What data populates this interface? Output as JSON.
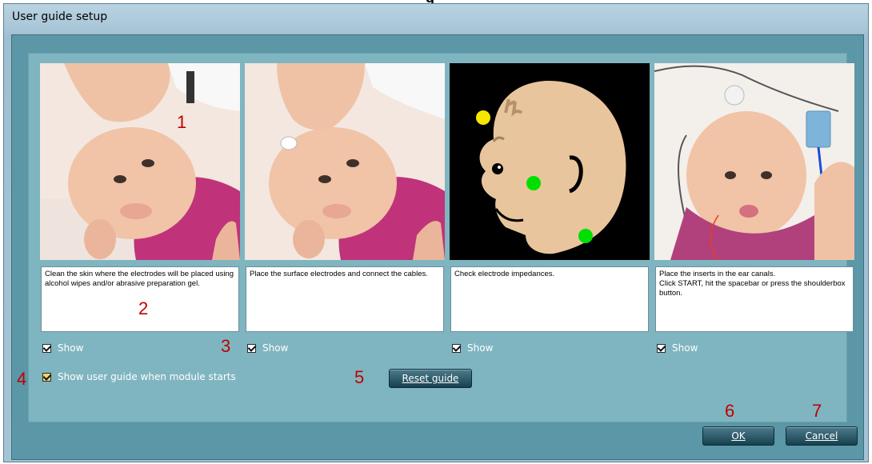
{
  "partial_top_title": "g",
  "window": {
    "title": "User guide setup"
  },
  "steps": [
    {
      "text": "Clean the skin where the electrodes will be placed using alcohol wipes and/or abrasive preparation gel.",
      "show_label": "Show",
      "checked": true
    },
    {
      "text": "Place the surface electrodes and connect the cables.",
      "show_label": "Show",
      "checked": true
    },
    {
      "text": "Check electrode impedances.",
      "show_label": "Show",
      "checked": true
    },
    {
      "text": "Place the inserts in the ear canals.\nClick START, hit the spacebar or press the shoulderbox button.",
      "show_label": "Show",
      "checked": true
    }
  ],
  "options": {
    "show_on_start_label": "Show user guide when module starts",
    "checked": true
  },
  "buttons": {
    "reset": "Reset guide",
    "ok": "OK",
    "cancel": "Cancel"
  },
  "markers": [
    "1",
    "2",
    "3",
    "4",
    "5",
    "6",
    "7"
  ],
  "colors": {
    "panel": "#7fb5c0",
    "client": "#5b97a6",
    "button": "#16414f",
    "marker": "#c00000"
  }
}
